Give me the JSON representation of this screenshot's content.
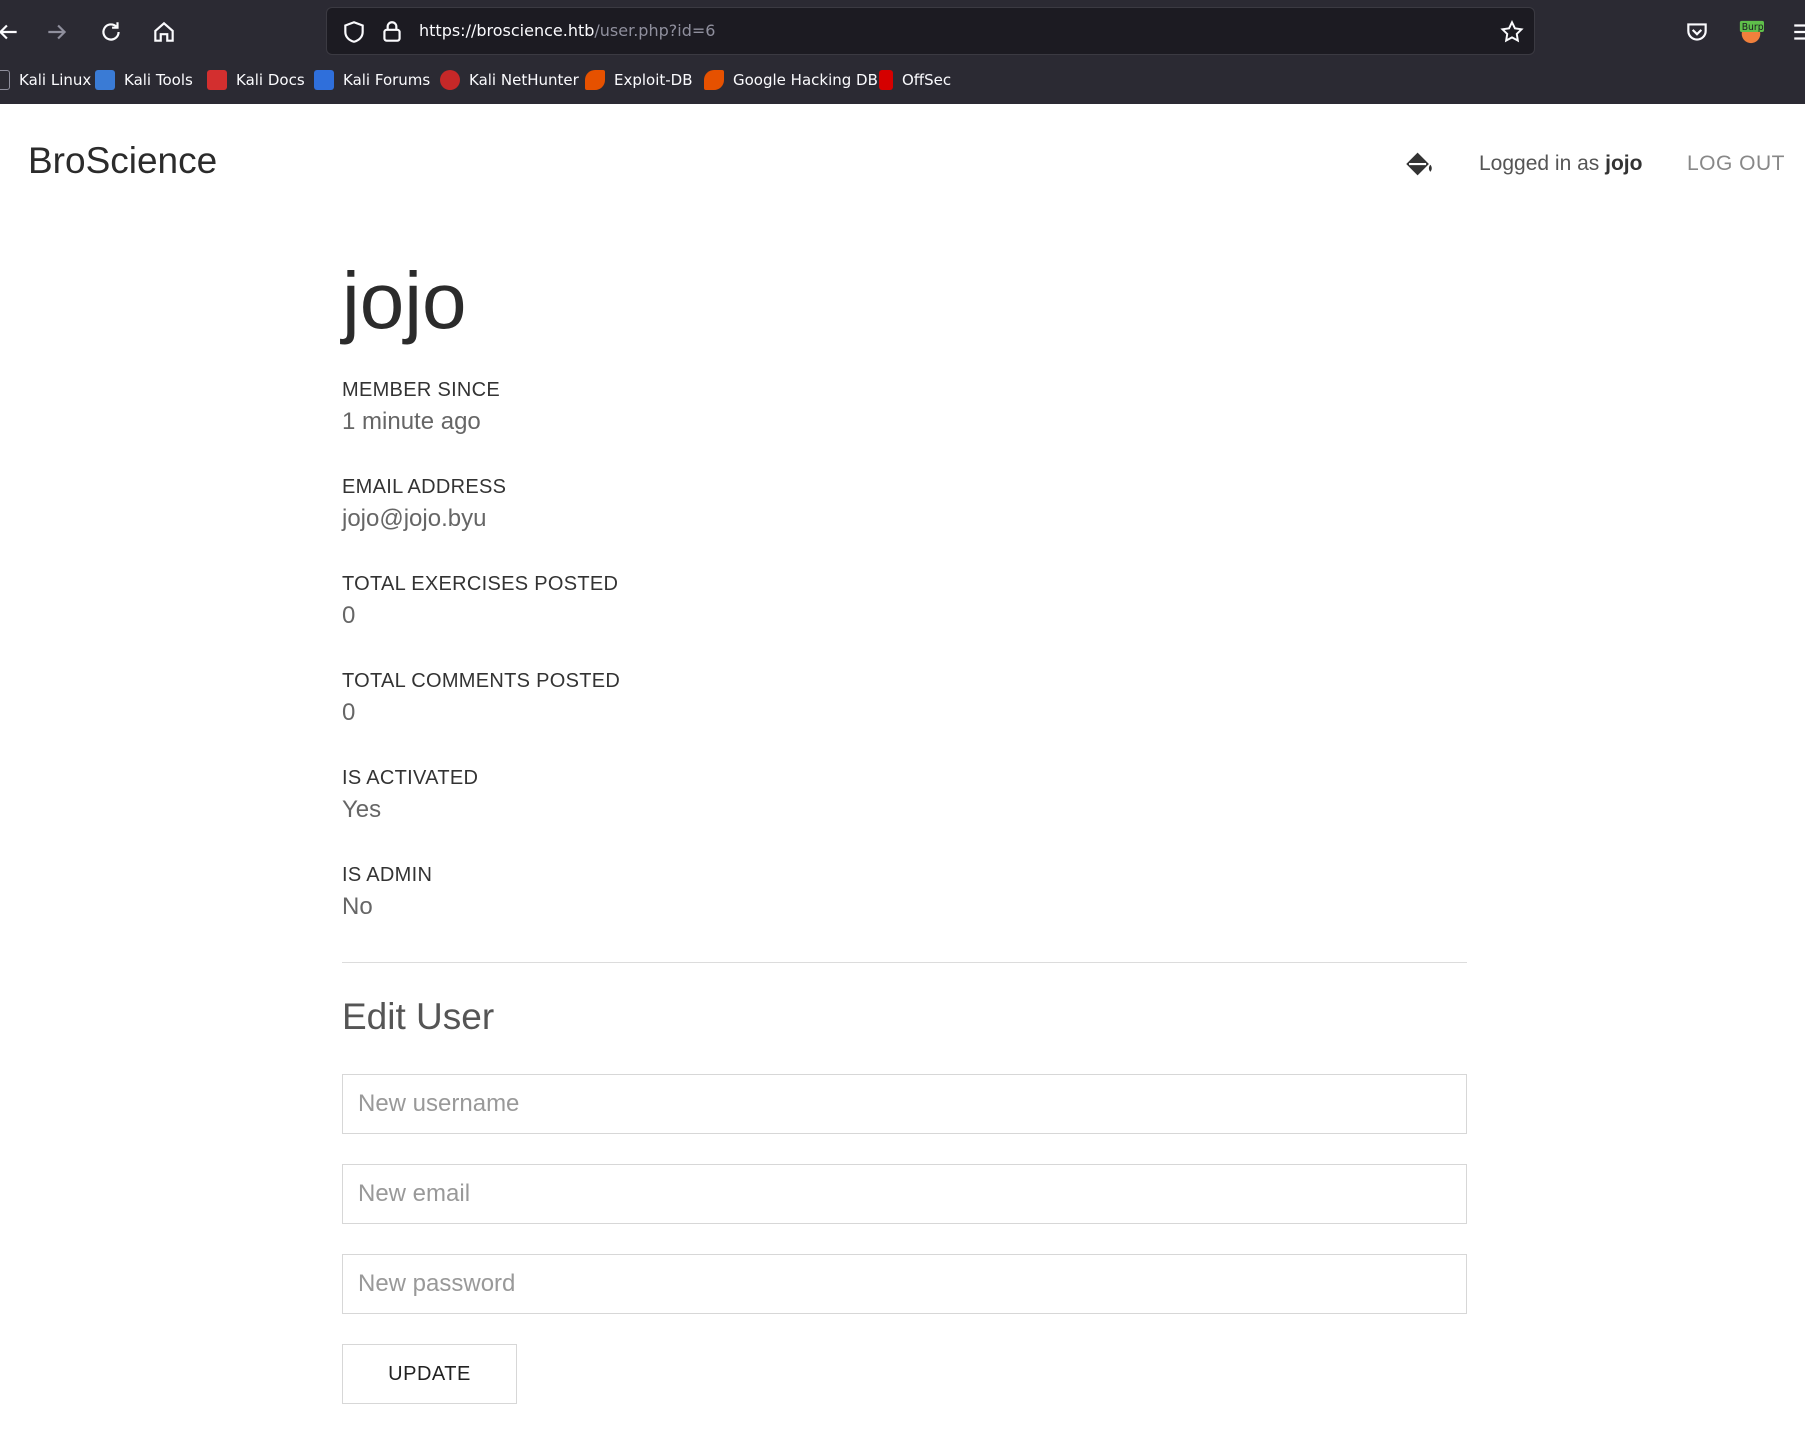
{
  "browser": {
    "url_host": "https://broscience.htb",
    "url_path": "/user.php?id=6",
    "extension_badge": "Burp",
    "bookmarks": [
      {
        "label": "Kali Linux",
        "icon": "kali-linux-icon",
        "color": "#2b2a33"
      },
      {
        "label": "Kali Tools",
        "icon": "kali-tools-icon",
        "color": "#3a7bd5"
      },
      {
        "label": "Kali Docs",
        "icon": "kali-docs-icon",
        "color": "#d32f2f"
      },
      {
        "label": "Kali Forums",
        "icon": "kali-forums-icon",
        "color": "#2f6fdb"
      },
      {
        "label": "Kali NetHunter",
        "icon": "kali-nethunter-icon",
        "color": "#c62828"
      },
      {
        "label": "Exploit-DB",
        "icon": "exploit-db-icon",
        "color": "#e65100"
      },
      {
        "label": "Google Hacking DB",
        "icon": "google-hacking-db-icon",
        "color": "#e65100"
      },
      {
        "label": "OffSec",
        "icon": "offsec-icon",
        "color": "#d50000"
      }
    ]
  },
  "header": {
    "brand": "BroScience",
    "logged_prefix": "Logged in as ",
    "logged_user": "jojo",
    "logout_label": "LOG OUT"
  },
  "profile": {
    "username": "jojo",
    "fields": [
      {
        "label": "MEMBER SINCE",
        "value": "1 minute ago"
      },
      {
        "label": "EMAIL ADDRESS",
        "value": "jojo@jojo.byu"
      },
      {
        "label": "TOTAL EXERCISES POSTED",
        "value": "0"
      },
      {
        "label": "TOTAL COMMENTS POSTED",
        "value": "0"
      },
      {
        "label": "IS ACTIVATED",
        "value": "Yes"
      },
      {
        "label": "IS ADMIN",
        "value": "No"
      }
    ]
  },
  "edit": {
    "title": "Edit User",
    "username_placeholder": "New username",
    "email_placeholder": "New email",
    "password_placeholder": "New password",
    "update_label": "UPDATE"
  }
}
